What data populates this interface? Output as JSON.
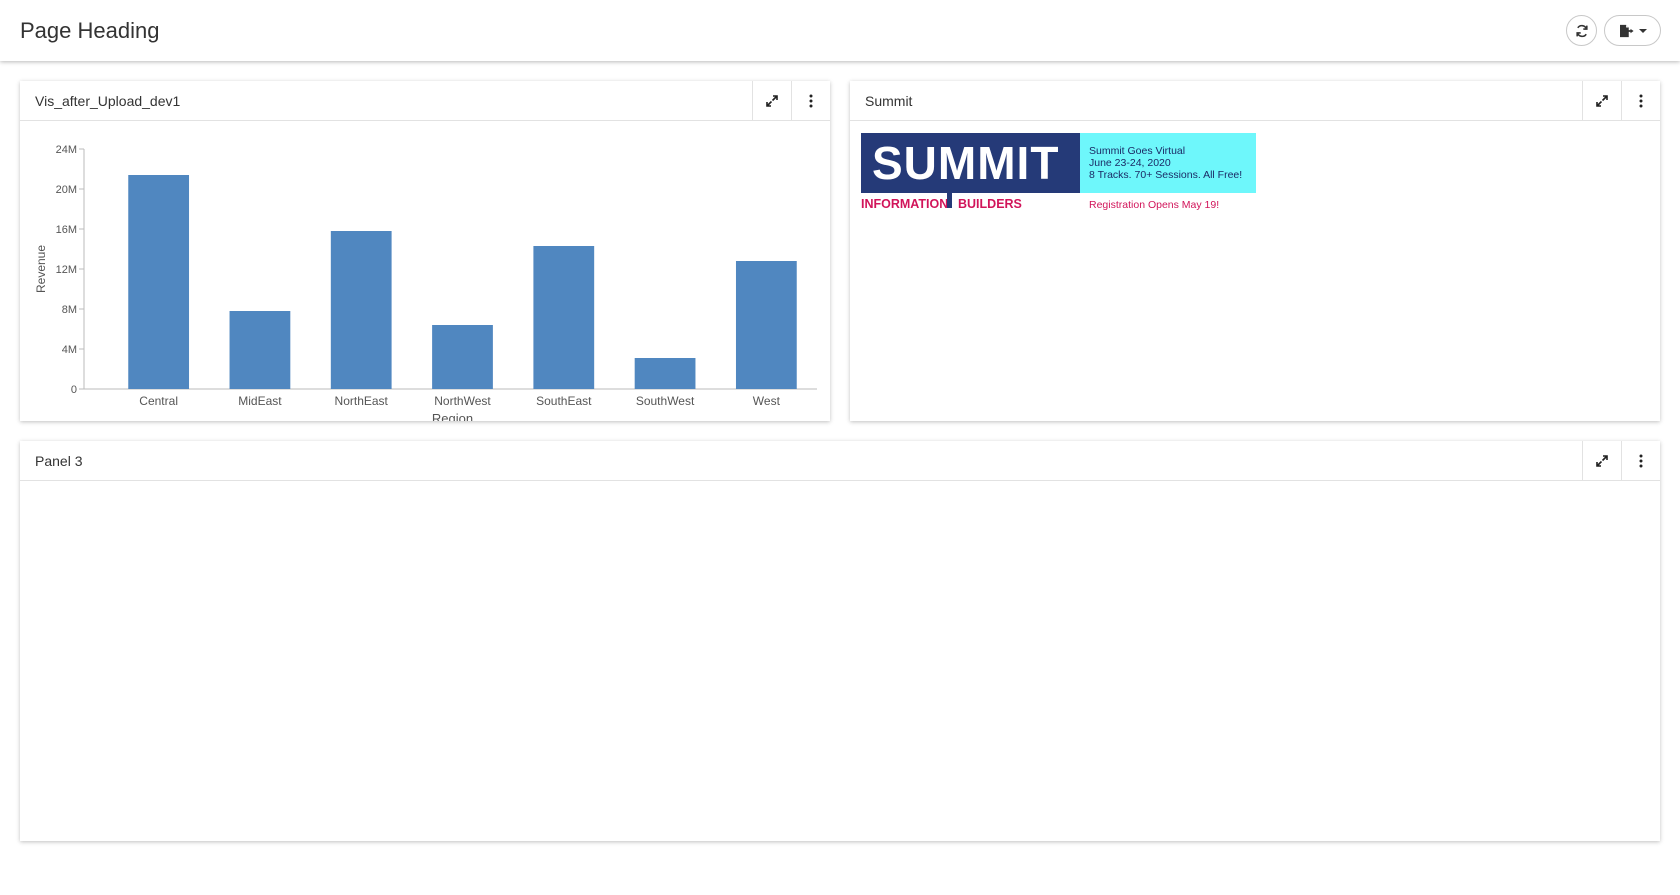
{
  "header": {
    "title": "Page Heading",
    "refresh_icon": "refresh-icon",
    "export_icon": "export-icon"
  },
  "panels": [
    {
      "title": "Vis_after_Upload_dev1",
      "expand_icon": "expand-icon",
      "menu_icon": "more-vertical-icon"
    },
    {
      "title": "Summit",
      "expand_icon": "expand-icon",
      "menu_icon": "more-vertical-icon"
    },
    {
      "title": "Panel 3",
      "expand_icon": "expand-icon",
      "menu_icon": "more-vertical-icon"
    }
  ],
  "banner": {
    "word": "SUMMIT",
    "left_text_1": "INFORMATION",
    "left_text_2": "BUILDERS",
    "line1": "Summit Goes Virtual",
    "line2": "June 23-24, 2020",
    "line3": "8 Tracks. 70+ Sessions. All Free!",
    "registration": "Registration Opens May 19!",
    "colors": {
      "navy": "#253a78",
      "cyan": "#6ef7fb",
      "magenta": "#d1145a"
    }
  },
  "chart_data": {
    "type": "bar",
    "categories": [
      "Central",
      "MidEast",
      "NorthEast",
      "NorthWest",
      "SouthEast",
      "SouthWest",
      "West"
    ],
    "values": [
      21400000,
      7800000,
      15800000,
      6400000,
      14300000,
      3100000,
      12800000
    ],
    "xlabel": "Region",
    "ylabel": "Revenue",
    "ylim": [
      0,
      24000000
    ],
    "yticks": [
      0,
      4000000,
      8000000,
      12000000,
      16000000,
      20000000,
      24000000
    ],
    "ytick_labels": [
      "0",
      "4M",
      "8M",
      "12M",
      "16M",
      "20M",
      "24M"
    ],
    "bar_color": "#5087c0",
    "grid": false,
    "legend": "none"
  }
}
